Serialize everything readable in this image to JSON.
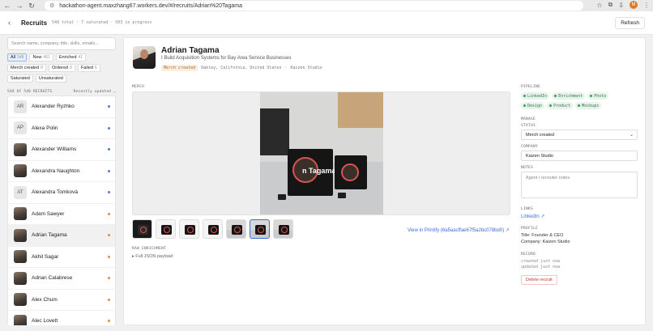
{
  "browser": {
    "url": "hackathon-agent.maxzhang67.workers.dev/#/recruits/Adrian%20Tagama",
    "avatar_letter": "M"
  },
  "header": {
    "title": "Recruits",
    "stats": "548 total · 7 saturated · 503 in progress",
    "refresh_label": "Refresh"
  },
  "sidebar": {
    "search_placeholder": "Search name, company, title, skills, emails...",
    "filters": [
      {
        "label": "All",
        "count": "548"
      },
      {
        "label": "New",
        "count": "461"
      },
      {
        "label": "Enriched",
        "count": "41"
      },
      {
        "label": "Merch created",
        "count": "8"
      },
      {
        "label": "Ordered",
        "count": "8"
      },
      {
        "label": "Failed",
        "count": "6"
      },
      {
        "label": "Saturated",
        "count": ""
      },
      {
        "label": "Unsaturated",
        "count": ""
      }
    ],
    "list_count": "548 OF 548 RECRUITS",
    "sort_label": "Recently updated",
    "items": [
      {
        "name": "Alexander Ryzhko",
        "initials": "AR",
        "dot": "#4a7be0"
      },
      {
        "name": "Alexa Polin",
        "initials": "AP",
        "dot": "#4a7be0"
      },
      {
        "name": "Alexander Williams",
        "initials": "",
        "dot": "#4a7be0"
      },
      {
        "name": "Alexandra Naughton",
        "initials": "",
        "dot": "#4a7be0"
      },
      {
        "name": "Alexandra Tomková",
        "initials": "AT",
        "dot": "#4a7be0"
      },
      {
        "name": "Adam Sawyer",
        "initials": "",
        "dot": "#e0922f"
      },
      {
        "name": "Adrian Tagama",
        "initials": "",
        "dot": "#e0922f"
      },
      {
        "name": "Akhil Sagar",
        "initials": "",
        "dot": "#e0922f"
      },
      {
        "name": "Adrian Calabrese",
        "initials": "",
        "dot": "#e0922f"
      },
      {
        "name": "Alex Chum",
        "initials": "",
        "dot": "#e0922f"
      },
      {
        "name": "Alec Lovett",
        "initials": "",
        "dot": "#e0922f"
      }
    ]
  },
  "profile": {
    "name": "Adrian Tagama",
    "tagline": "I Build Acquisition Systems for Bay Area Service Businesses",
    "status_badge": "Merch created",
    "location": "Oakley, California, United States",
    "company": "Kaizen Studio"
  },
  "merch": {
    "label": "MERCH",
    "mug_text": "n Tagama",
    "printify_link": "View in Printify (6a5aacffae67f5a2bc078bd0) ↗",
    "raw_label": "RAW ENRICHMENT",
    "raw_toggle": "▸ Full JSON payload"
  },
  "pipeline": {
    "label": "PIPELINE",
    "steps": [
      "LinkedIn",
      "Enrichment",
      "Photo",
      "Design",
      "Product",
      "Mockups"
    ]
  },
  "manage": {
    "label": "MANAGE",
    "status_label": "STATUS",
    "status_value": "Merch created",
    "company_label": "COMPANY",
    "company_value": "Kaizen Studio",
    "notes_label": "NOTES",
    "notes_placeholder": "Agent / recruiter notes"
  },
  "links": {
    "label": "LINKS",
    "linkedin": "LinkedIn ↗"
  },
  "profile_info": {
    "label": "PROFILE",
    "title_line": "Title: Founder & CEO",
    "company_line": "Company: Kaizen Studio"
  },
  "record": {
    "label": "RECORD",
    "created": "created just now",
    "updated": "updated just now",
    "delete_label": "Delete recruit"
  }
}
